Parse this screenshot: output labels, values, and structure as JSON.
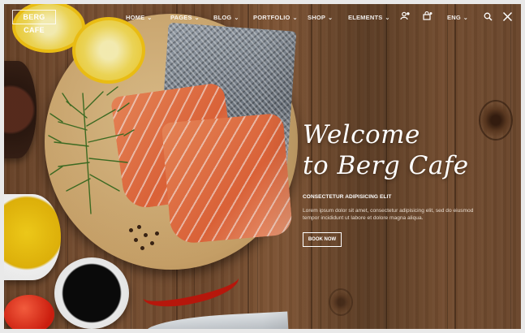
{
  "logo": "BERG CAFE",
  "nav": {
    "items": [
      {
        "label": "HOME",
        "chevron": "⌄"
      },
      {
        "label": "PAGES",
        "chevron": "⌄"
      },
      {
        "label": "BLOG",
        "chevron": "⌄"
      },
      {
        "label": "PORTFOLIO",
        "chevron": "⌄"
      },
      {
        "label": "SHOP",
        "chevron": "⌄"
      },
      {
        "label": "ELEMENTS",
        "chevron": "⌄"
      }
    ],
    "language": "ENG",
    "language_chevron": "⌄",
    "icons": [
      "user-icon",
      "cart-icon",
      "search-icon",
      "close-icon"
    ]
  },
  "hero": {
    "title_line1": "Welcome",
    "title_line2": "to Berg Cafe",
    "subtitle": "CONSECTETUR ADIPISICING ELIT",
    "body": "Lorem ipsum dolor sit amet, consectetur adipisicing elit, sed do eiusmod tempor incididunt ut labore et dolore magna aliqua.",
    "button": "BOOK NOW"
  }
}
